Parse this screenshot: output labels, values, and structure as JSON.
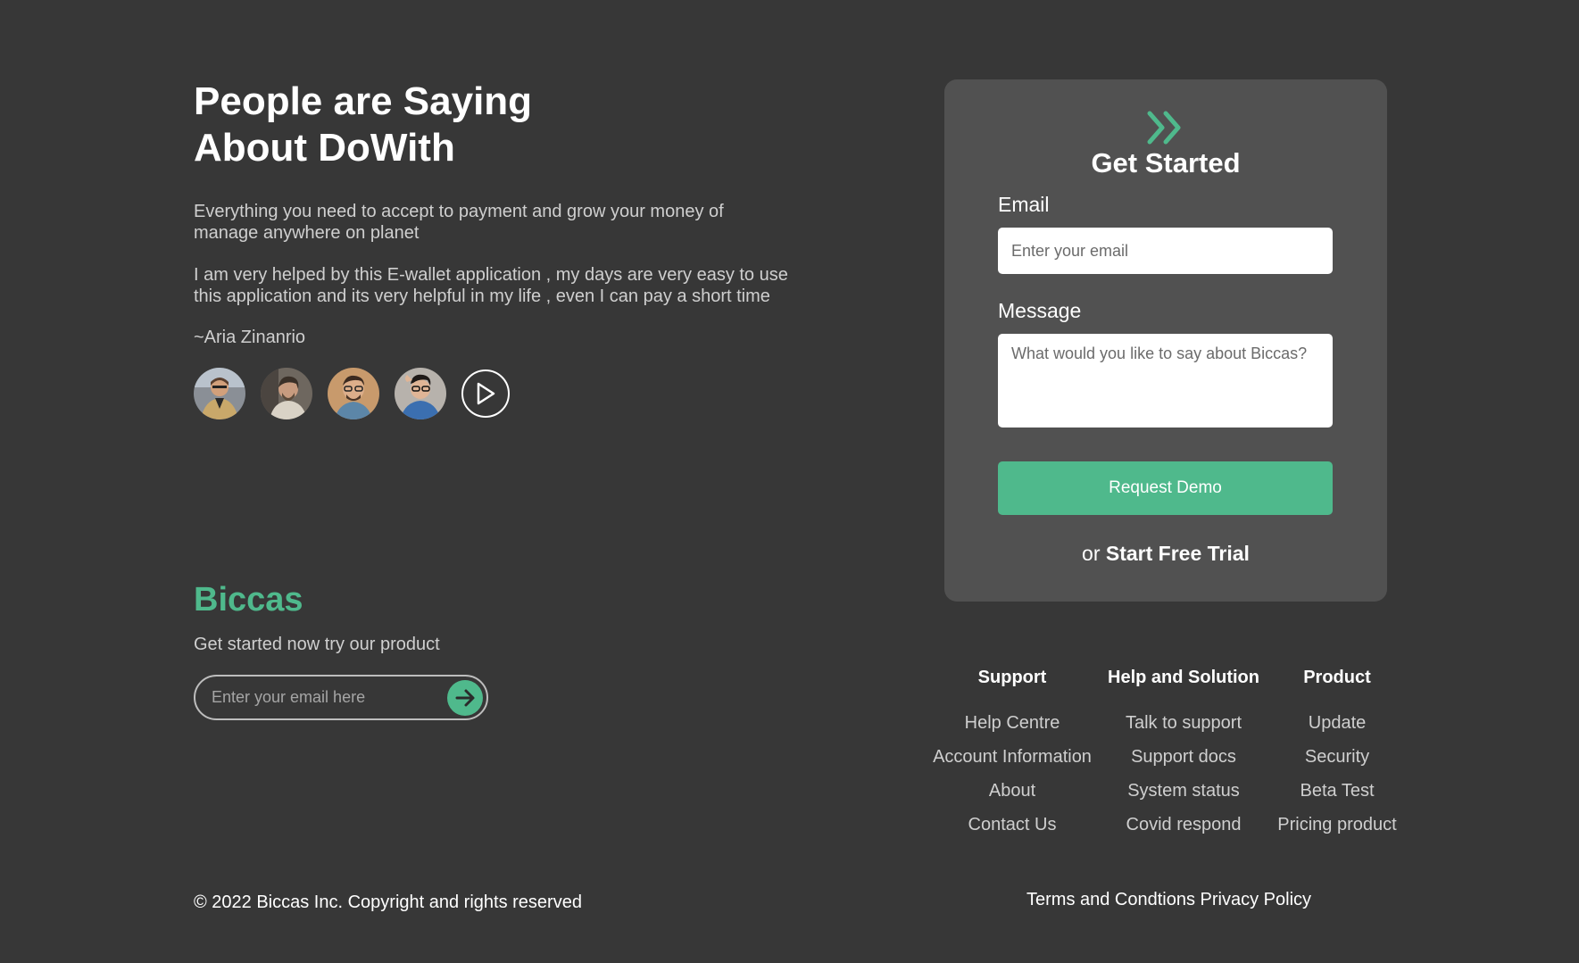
{
  "testimonial": {
    "heading_line1": "People are Saying",
    "heading_line2": "About DoWith",
    "intro": "Everything you need to accept to payment and grow your money of manage anywhere on planet",
    "quote": "I am very helped by this E-wallet application , my days are very easy to use this application and its very helpful in my life , even I can pay a short time",
    "author": "~Aria Zinanrio",
    "play_icon": "play-icon"
  },
  "brand": {
    "name": "Biccas",
    "tagline": "Get started now try our product",
    "newsletter_placeholder": "Enter your email here",
    "submit_icon": "arrow-right-icon"
  },
  "card": {
    "icon": "double-chevron-right-icon",
    "title": "Get Started",
    "email_label": "Email",
    "email_placeholder": "Enter your email",
    "message_label": "Message",
    "message_placeholder": "What would you like to say about Biccas?",
    "demo_button": "Request Demo",
    "trial_prefix": "or",
    "trial_link": "Start Free Trial"
  },
  "footer": {
    "columns": [
      {
        "title": "Support",
        "links": [
          "Help Centre",
          "Account Information",
          "About",
          "Contact Us"
        ]
      },
      {
        "title": "Help and Solution",
        "links": [
          "Talk to support",
          "Support docs",
          "System status",
          "Covid respond"
        ]
      },
      {
        "title": "Product",
        "links": [
          "Update",
          "Security",
          "Beta Test",
          "Pricing product"
        ]
      }
    ],
    "copyright": "© 2022 Biccas Inc. Copyright and rights reserved",
    "terms": "Terms and Condtions",
    "privacy": "Privacy Policy"
  },
  "colors": {
    "background": "#373737",
    "card": "#515151",
    "accent": "#4fb98c"
  }
}
